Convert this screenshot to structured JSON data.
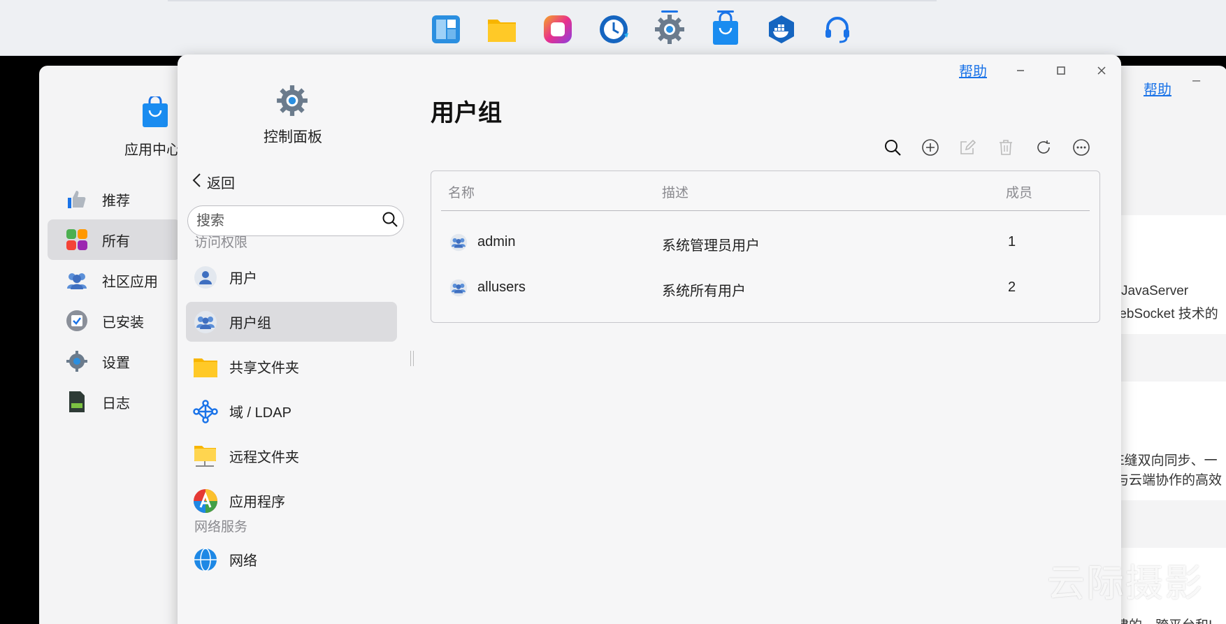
{
  "dock": {
    "items": [
      {
        "name": "app-launcher-icon",
        "active": false
      },
      {
        "name": "file-manager-icon",
        "active": false
      },
      {
        "name": "photos-icon",
        "active": false
      },
      {
        "name": "backup-clock-icon",
        "active": false
      },
      {
        "name": "control-panel-gear-icon",
        "active": true
      },
      {
        "name": "app-center-bag-icon",
        "active": true
      },
      {
        "name": "docker-icon",
        "active": false
      },
      {
        "name": "support-headset-icon",
        "active": false
      }
    ]
  },
  "back_window": {
    "app_name": "应用中心",
    "help": "帮助",
    "minimize": "–",
    "nav": [
      {
        "label": "推荐",
        "icon": "thumbs-up-icon"
      },
      {
        "label": "所有",
        "icon": "apps-grid-icon",
        "active": true
      },
      {
        "label": "社区应用",
        "icon": "community-icon"
      },
      {
        "label": "已安装",
        "icon": "installed-icon"
      },
      {
        "label": "设置",
        "icon": "settings-gear-icon"
      },
      {
        "label": "日志",
        "icon": "log-file-icon"
      }
    ],
    "snippets": {
      "line1": "JavaServer",
      "line2": "/ebSocket 技术的",
      "line3": "E缝双向同步、一",
      "line4": "与云端协作的高效",
      "line5": "建的、跨平台和I"
    }
  },
  "front_window": {
    "help": "帮助",
    "app_title": "控制面板",
    "back": "返回",
    "search": {
      "placeholder": "搜索",
      "value": ""
    },
    "sections": {
      "access": "访问权限",
      "network": "网络服务"
    },
    "nav_access": [
      {
        "label": "用户",
        "icon": "user-icon"
      },
      {
        "label": "用户组",
        "icon": "user-group-icon",
        "active": true
      },
      {
        "label": "共享文件夹",
        "icon": "shared-folder-icon"
      },
      {
        "label": "域 / LDAP",
        "icon": "domain-ldap-icon"
      },
      {
        "label": "远程文件夹",
        "icon": "remote-folder-icon"
      },
      {
        "label": "应用程序",
        "icon": "applications-icon"
      }
    ],
    "nav_network": [
      {
        "label": "网络",
        "icon": "network-globe-icon"
      }
    ],
    "page_title": "用户组",
    "toolbar": [
      "search-icon",
      "add-icon",
      "edit-icon",
      "delete-icon",
      "refresh-icon",
      "more-icon"
    ],
    "table": {
      "columns": {
        "name": "名称",
        "desc": "描述",
        "members": "成员"
      },
      "rows": [
        {
          "name": "admin",
          "desc": "系统管理员用户",
          "members": "1"
        },
        {
          "name": "allusers",
          "desc": "系统所有用户",
          "members": "2"
        }
      ]
    }
  },
  "watermark": "云际摄影",
  "colors": {
    "accent": "#1a73e8",
    "window_bg": "#f6f6f7",
    "active_item_bg": "#dcdcdf",
    "section_label": "#8a8a8f"
  }
}
